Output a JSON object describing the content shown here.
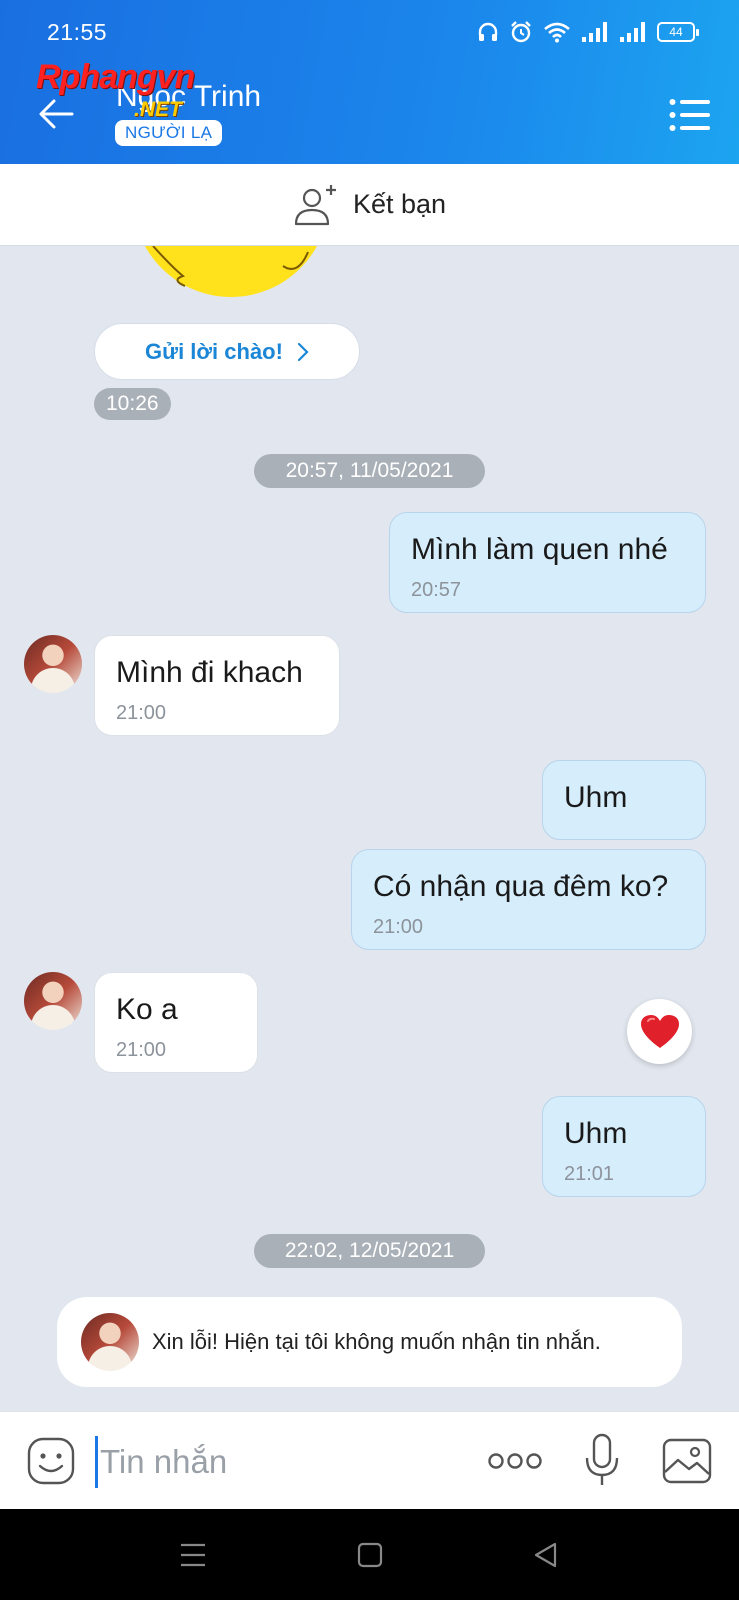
{
  "status_bar": {
    "time": "21:55",
    "battery": "44"
  },
  "header": {
    "contact_name": "Ngọc Trinh",
    "badge": "NGƯỜI LẠ",
    "watermark_main": "Rphangvn",
    "watermark_sub": ".NET"
  },
  "add_friend": {
    "label": "Kết bạn"
  },
  "greeting": {
    "label": "Gửi lời chào!",
    "time": "10:26"
  },
  "conversation": {
    "date_1": "20:57, 11/05/2021",
    "date_2": "22:02, 12/05/2021",
    "messages": [
      {
        "sender": "me",
        "text": "Mình làm quen nhé",
        "time": "20:57"
      },
      {
        "sender": "them",
        "text": "Mình đi khach",
        "time": "21:00"
      },
      {
        "sender": "me",
        "text": "Uhm",
        "time": ""
      },
      {
        "sender": "me",
        "text": "Có nhận qua đêm ko?",
        "time": "21:00"
      },
      {
        "sender": "them",
        "text": "Ko a",
        "time": "21:00"
      },
      {
        "sender": "me",
        "text": "Uhm",
        "time": "21:01"
      }
    ],
    "reaction": "heart",
    "notice": "Xin lỗi! Hiện tại tôi không muốn nhận tin nhắn."
  },
  "composer": {
    "placeholder": "Tin nhắn"
  },
  "colors": {
    "header_start": "#1a6fe0",
    "header_end": "#1ca4f0",
    "my_bubble": "#d6edfc",
    "accent": "#1c86d6",
    "heart": "#e0202a"
  }
}
